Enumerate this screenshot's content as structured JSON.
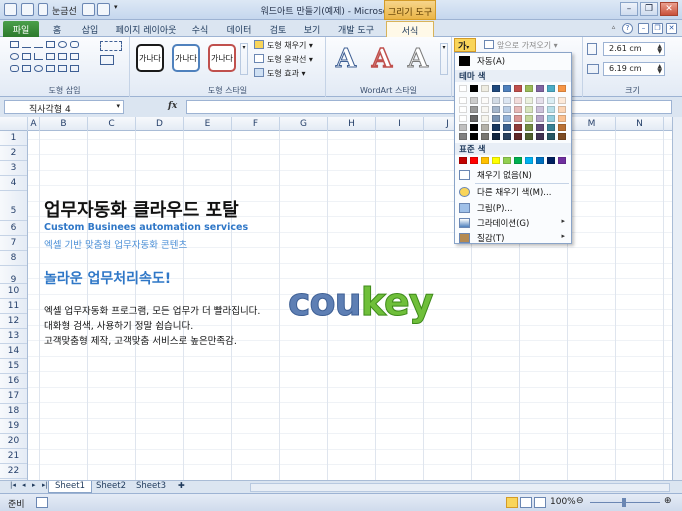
{
  "window": {
    "title": "워드아트 만들기(예제) - Microsoft Excel",
    "context_tab_group": "그리기 도구",
    "quick_access_label": "눈금선"
  },
  "tabs": [
    "파일",
    "홈",
    "삽입",
    "페이지 레이아웃",
    "수식",
    "데이터",
    "검토",
    "보기",
    "개발 도구",
    "서식"
  ],
  "ribbon": {
    "groups": {
      "insert_shapes": "도형 삽입",
      "shape_styles": "도형 스타일",
      "wordart_styles": "WordArt 스타일",
      "size": "크기"
    },
    "style_sample": "가나다",
    "shape_fill": "도형 채우기",
    "shape_outline": "도형 윤곽선",
    "shape_effects": "도형 효과",
    "bring_forward": "앞으로 가져오기",
    "text_fill_icon": "가",
    "height": "2.61 cm",
    "width": "6.19 cm"
  },
  "formula_bar": {
    "name_box": "직사각형 4",
    "fx": "fx",
    "value": ""
  },
  "columns": [
    "A",
    "B",
    "C",
    "D",
    "E",
    "F",
    "G",
    "H",
    "I",
    "J",
    "K",
    "L",
    "M",
    "N"
  ],
  "rows": [
    "1",
    "2",
    "3",
    "4",
    "5",
    "6",
    "7",
    "8",
    "9",
    "10",
    "11",
    "12",
    "13",
    "14",
    "15",
    "16",
    "17",
    "18",
    "19",
    "20",
    "21",
    "22",
    "23"
  ],
  "sheet": {
    "title": "업무자동화 클라우드 포탈",
    "subtitle_en": "Custom Businees automation services",
    "subtitle_ko": "엑셀 기반 맞춤형 업무자동화 콘텐츠",
    "headline": "놀라운 업무처리속도!",
    "lines": [
      "엑셀 업무자동화 프로그램, 모든 업무가 더 빨라집니다.",
      "대화형 검색, 사용하기 정말 쉽습니다.",
      "고객맞춤형 제작, 고객맞춤 서비스로 높은만족감."
    ],
    "wordart": {
      "part1": "cou",
      "part2": "key"
    }
  },
  "sheet_tabs": [
    "Sheet1",
    "Sheet2",
    "Sheet3"
  ],
  "status": {
    "ready": "준비",
    "zoom": "100%"
  },
  "dropdown": {
    "auto": "자동(A)",
    "theme_colors": "테마 색",
    "standard_colors": "표준 색",
    "no_fill": "채우기 없음(N)",
    "more_colors": "다른 채우기 색(M)...",
    "picture": "그림(P)...",
    "gradient": "그라데이션(G)",
    "texture": "질감(T)",
    "theme_top": [
      "#ffffff",
      "#000000",
      "#eeece1",
      "#1f497d",
      "#4f81bd",
      "#c0504d",
      "#9bbb59",
      "#8064a2",
      "#4bacc6",
      "#f79646"
    ],
    "standard": [
      "#c00000",
      "#ff0000",
      "#ffc000",
      "#ffff00",
      "#92d050",
      "#00b050",
      "#00b0f0",
      "#0070c0",
      "#002060",
      "#7030a0"
    ]
  }
}
